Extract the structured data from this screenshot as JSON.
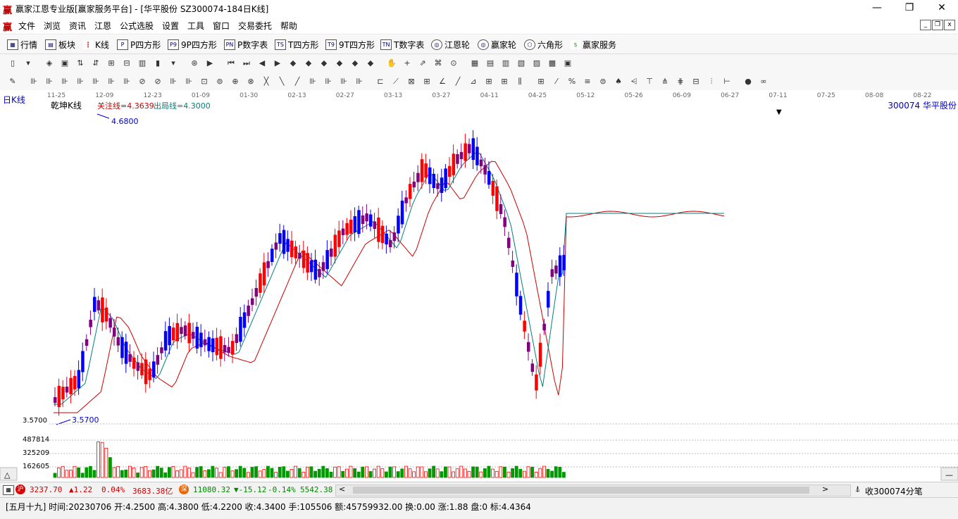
{
  "window": {
    "title": "赢家江恩专业版[赢家服务平台] - [华平股份   SZ300074-184日K线]",
    "minimize": "—",
    "restore": "❐",
    "close": "✕"
  },
  "menu": [
    "文件",
    "浏览",
    "资讯",
    "江恩",
    "公式选股",
    "设置",
    "工具",
    "窗口",
    "交易委托",
    "帮助"
  ],
  "nav": [
    {
      "icon": "grid-icon",
      "label": "行情"
    },
    {
      "icon": "blocks-icon",
      "label": "板块"
    },
    {
      "icon": "candle-icon",
      "label": "K线"
    },
    {
      "icon": "P",
      "label": "P四方形"
    },
    {
      "icon": "P9",
      "label": "9P四方形"
    },
    {
      "icon": "PN",
      "label": "P数字表"
    },
    {
      "icon": "TS",
      "label": "T四方形"
    },
    {
      "icon": "T9",
      "label": "9T四方形"
    },
    {
      "icon": "TN",
      "label": "T数字表"
    },
    {
      "icon": "wheel-icon",
      "label": "江恩轮"
    },
    {
      "icon": "wheel-icon",
      "label": "赢家轮"
    },
    {
      "icon": "hexagon-icon",
      "label": "六角形"
    },
    {
      "icon": "dollar-icon",
      "label": "赢家服务"
    }
  ],
  "chart": {
    "period_label": "日K线",
    "indicator_name": "乾坤K线",
    "focus_line": "关注线=4.3639",
    "exit_line": "出局线=4.3000",
    "stock": "300074  华平股份",
    "high_label": "4.6800",
    "low_label": "3.5700",
    "price_axis_low": "3.5700",
    "vol_axis": [
      "487814",
      "325209",
      "162605"
    ],
    "dates": [
      "11-25",
      "12-09",
      "12-23",
      "01-09",
      "01-30",
      "02-13",
      "02-27",
      "03-13",
      "03-27",
      "04-11",
      "04-25",
      "05-12",
      "05-26",
      "06-09",
      "06-27",
      "07-11",
      "07-25",
      "08-08",
      "08-22"
    ]
  },
  "status": {
    "index1_value": "3237.70",
    "index1_change": "▲1.22",
    "index1_pct": "0.04%",
    "index1_amount": "3683.38亿",
    "index2_value": "11080.32",
    "index2_change": "▼-15.12",
    "index2_pct": "-0.14%",
    "index2_amount": "5542.38",
    "right_text": "收300074分笔"
  },
  "info": {
    "text": "[五月十九] 时间:20230706 开:4.2500 高:4.3800 低:4.2200 收:4.3400 手:105506 额:45759932.00 换:0.00 涨:1.88 盘:0 标:4.4364"
  },
  "colors": {
    "up": "#ff0000",
    "down": "#0000ff",
    "mixed": "#800080",
    "volume_up": "#ff0000",
    "volume_down": "#009900",
    "ma_long": "#cc0000",
    "ma_short": "#008080"
  }
}
